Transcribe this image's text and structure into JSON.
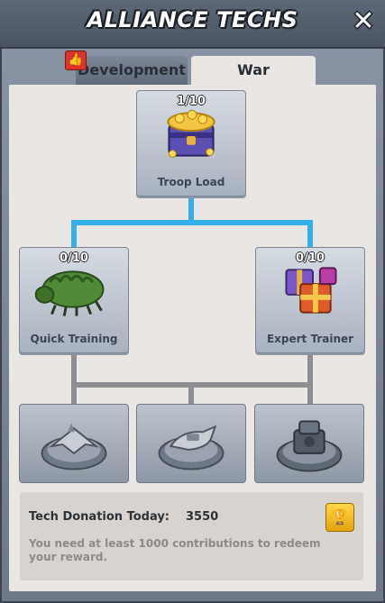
{
  "header": {
    "title": "ALLIANCE TECHS",
    "close_icon": "close-icon"
  },
  "tabs": [
    {
      "label": "Development",
      "active": false,
      "badge_icon": "thumbs-up-icon"
    },
    {
      "label": "War",
      "active": true
    }
  ],
  "tree": {
    "top": {
      "level": "1/10",
      "name": "Troop Load",
      "icon": "gold-treasure-chest-icon"
    },
    "left": {
      "level": "0/10",
      "name": "Quick Training",
      "icon": "green-armored-bug-icon"
    },
    "right": {
      "level": "0/10",
      "name": "Expert Trainer",
      "icon": "gift-boxes-icon"
    },
    "locked": [
      {
        "icon": "fighter-jet-emblem-icon"
      },
      {
        "icon": "hover-tank-emblem-icon"
      },
      {
        "icon": "turret-emblem-icon"
      }
    ],
    "colors": {
      "active_link": "#34b1e8",
      "locked_link": "#8d8f93"
    }
  },
  "donation": {
    "label": "Tech Donation Today:",
    "value": "3550",
    "note": "You need at least 1000 contributions to redeem your reward.",
    "button_icon": "trophy-icon"
  }
}
